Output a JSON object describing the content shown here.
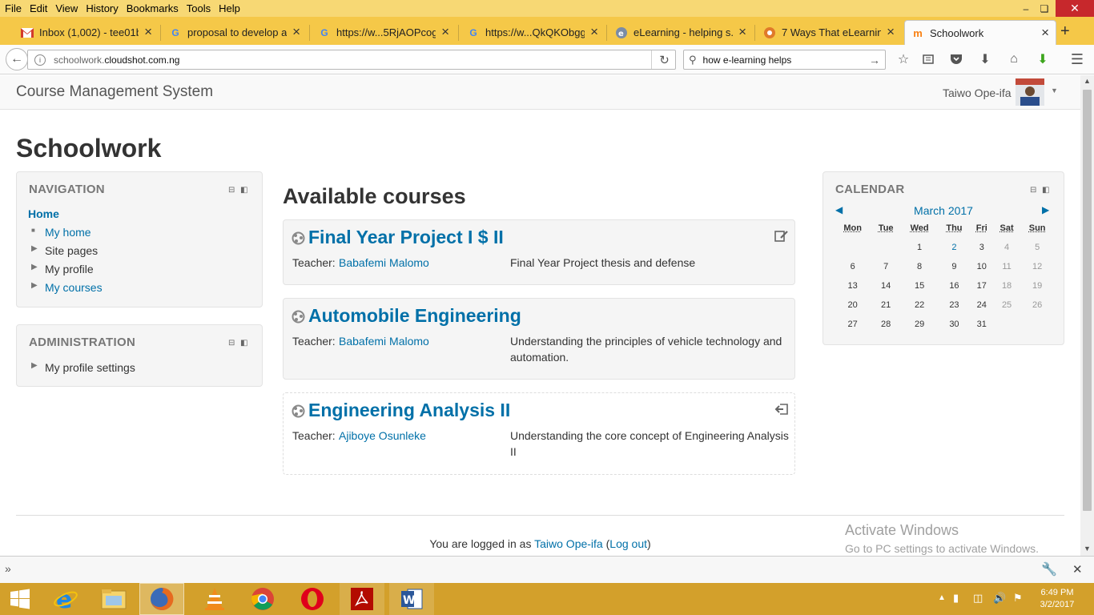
{
  "menu": [
    "File",
    "Edit",
    "View",
    "History",
    "Bookmarks",
    "Tools",
    "Help"
  ],
  "tabs": [
    {
      "title": "Inbox (1,002) - tee01b...",
      "icon": "gmail-icon"
    },
    {
      "title": "proposal to develop a...",
      "icon": "google-icon"
    },
    {
      "title": "https://w...5RjAOPcog",
      "icon": "google-icon"
    },
    {
      "title": "https://w...QkQKObgg",
      "icon": "google-icon"
    },
    {
      "title": "eLearning - helping s...",
      "icon": "elearning-icon"
    },
    {
      "title": "7 Ways That eLearnin...",
      "icon": "elearning-icon"
    },
    {
      "title": "Schoolwork",
      "icon": "moodle-icon"
    }
  ],
  "url": {
    "prefix": "schoolwork.",
    "domain": "cloudshot.com.ng"
  },
  "search": {
    "value": "how e-learning helps"
  },
  "site": {
    "name": "Course Management System",
    "user": "Taiwo Ope-ifa",
    "page_title": "Schoolwork"
  },
  "navigation": {
    "title": "NAVIGATION",
    "home": "Home",
    "items": [
      {
        "label": "My home",
        "link": true
      },
      {
        "label": "Site pages",
        "link": false
      },
      {
        "label": "My profile",
        "link": false
      },
      {
        "label": "My courses",
        "link": true
      }
    ]
  },
  "administration": {
    "title": "ADMINISTRATION",
    "items": [
      {
        "label": "My profile settings"
      }
    ]
  },
  "courses_heading": "Available courses",
  "courses": [
    {
      "name": "Final Year Project I $ II",
      "teacher_label": "Teacher:",
      "teacher": "Babafemi Malomo",
      "summary": "Final Year Project thesis and defense"
    },
    {
      "name": "Automobile Engineering",
      "teacher_label": "Teacher:",
      "teacher": "Babafemi Malomo",
      "summary": "Understanding the principles of vehicle technology and automation."
    },
    {
      "name": "Engineering Analysis II",
      "teacher_label": "Teacher:",
      "teacher": "Ajiboye Osunleke",
      "summary": "Understanding the core concept of Engineering Analysis II"
    }
  ],
  "calendar": {
    "title": "CALENDAR",
    "month": "March 2017",
    "days": [
      "Mon",
      "Tue",
      "Wed",
      "Thu",
      "Fri",
      "Sat",
      "Sun"
    ],
    "weeks": [
      [
        "",
        "",
        "1",
        "2",
        "3",
        "4",
        "5"
      ],
      [
        "6",
        "7",
        "8",
        "9",
        "10",
        "11",
        "12"
      ],
      [
        "13",
        "14",
        "15",
        "16",
        "17",
        "18",
        "19"
      ],
      [
        "20",
        "21",
        "22",
        "23",
        "24",
        "25",
        "26"
      ],
      [
        "27",
        "28",
        "29",
        "30",
        "31",
        "",
        ""
      ]
    ]
  },
  "footer": {
    "text": "You are logged in as",
    "user": "Taiwo Ope-ifa",
    "logout": "Log out"
  },
  "activate": {
    "line1": "Activate Windows",
    "line2": "Go to PC settings to activate Windows."
  },
  "clock": {
    "time": "6:49 PM",
    "date": "3/2/2017"
  }
}
